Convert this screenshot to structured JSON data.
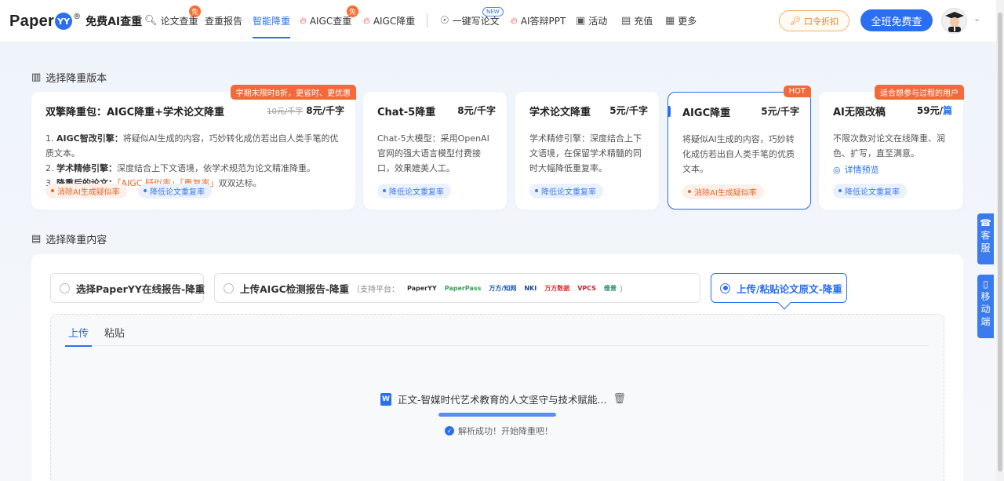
{
  "brand": {
    "name": "Paper",
    "mark": "YY",
    "reg": "®",
    "subtitle": "免费AI查重"
  },
  "nav": {
    "items": [
      {
        "label": "论文查重",
        "badge": "免"
      },
      {
        "label": "查重报告"
      },
      {
        "label": "智能降重",
        "active": true
      },
      {
        "label": "AIGC查重",
        "badge": "免"
      },
      {
        "label": "AIGC降重"
      },
      {
        "label": "一键写论文",
        "badge": "NEW"
      },
      {
        "label": "AI答辩PPT"
      },
      {
        "label": "活动"
      },
      {
        "label": "充值"
      },
      {
        "label": "更多"
      }
    ],
    "code_button": "口令折扣",
    "free_button": "全班免费查"
  },
  "version_section": {
    "title": "选择降重版本"
  },
  "cards": [
    {
      "title": "双擎降重包：AIGC降重+学术论文降重",
      "old_price": "10元/千字",
      "price": "8元/千字",
      "ribbon": "学期末限时8折，更省时、更优惠",
      "lines": [
        {
          "num": "1.",
          "head": "AIGC智改引擎：",
          "text": "将疑似AI生成的内容，巧妙转化成仿若出自人类手笔的优质文本。"
        },
        {
          "num": "2.",
          "head": "学术精修引擎：",
          "text": "深度结合上下文语境，依学术规范为论文精准降重。"
        },
        {
          "num": "3.",
          "head": "降重后的论文：",
          "hl": "「AIGC 疑似率」「重复率」",
          "text": "双双达标。"
        }
      ],
      "tags": [
        "消除AI生成疑似率",
        "降低论文重复率"
      ]
    },
    {
      "title": "Chat-5降重",
      "price": "8元/千字",
      "desc": "Chat-5大模型：采用OpenAI官网的强大语言模型付费接口，效果媲美人工。",
      "tags": [
        "降低论文重复率"
      ]
    },
    {
      "title": "学术论文降重",
      "price": "5元/千字",
      "desc": "学术精修引擎：深度结合上下文语境，在保留学术精髓的同时大幅降低重复率。",
      "tags": [
        "降低论文重复率"
      ]
    },
    {
      "title": "AIGC降重",
      "price": "5元/千字",
      "ribbon": "HOT",
      "desc": "将疑似AI生成的内容，巧妙转化成仿若出自人类手笔的优质文本。",
      "tags": [
        "消除AI生成疑似率"
      ]
    },
    {
      "title": "AI无限改稿",
      "price": "59元/",
      "price_unit": "篇",
      "ribbon": "适合想参与过程的用户",
      "desc": "不限次数对论文在线降重、润色、扩写，直至满意。",
      "preview": "详情预览",
      "tags": [
        "降低论文重复率"
      ]
    }
  ],
  "content_section": {
    "title": "选择降重内容"
  },
  "options": [
    {
      "label": "选择PaperYY在线报告-降重"
    },
    {
      "label": "上传AIGC检测报告-降重",
      "note": "（支持平台：",
      "note_end": "）",
      "platforms": [
        "PaperYY",
        "PaperPass",
        "万方/知网",
        "NKI",
        "万方数据",
        "VPCS",
        "维普"
      ]
    },
    {
      "label": "上传/粘贴论文原文-降重",
      "active": true
    }
  ],
  "upload": {
    "tabs": [
      "上传",
      "粘贴"
    ],
    "file_name": "正文-智媒时代艺术教育的人文坚守与技术赋能...",
    "file_icon": "W",
    "progress": 1.0,
    "status": "解析成功！开始降重吧！"
  },
  "side": {
    "service": [
      "客",
      "服"
    ],
    "mobile": [
      "移",
      "动",
      "端"
    ]
  },
  "colors": {
    "primary": "#2b6ff0",
    "orange": "#f26a3a"
  }
}
